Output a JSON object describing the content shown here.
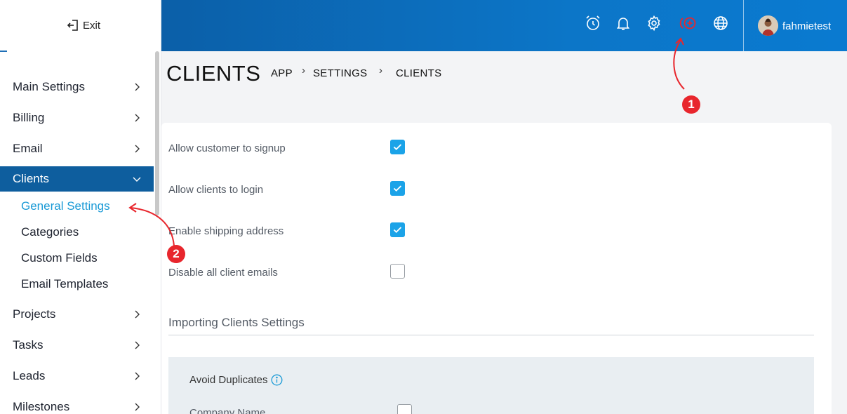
{
  "sidebar": {
    "exit_label": "Exit",
    "items": [
      {
        "label": "Main Settings"
      },
      {
        "label": "Billing"
      },
      {
        "label": "Email"
      },
      {
        "label": "Clients"
      },
      {
        "label": "Projects"
      },
      {
        "label": "Tasks"
      },
      {
        "label": "Leads"
      },
      {
        "label": "Milestones"
      }
    ],
    "clients_sub": [
      {
        "label": "General Settings"
      },
      {
        "label": "Categories"
      },
      {
        "label": "Custom Fields"
      },
      {
        "label": "Email Templates"
      }
    ]
  },
  "topbar": {
    "icons": [
      "alarm-clock-icon",
      "bell-icon",
      "gear-icon",
      "add-circle-icon",
      "globe-icon"
    ],
    "username": "fahmietest",
    "highlight_color": "#e8262d"
  },
  "header": {
    "title": "CLIENTS",
    "breadcrumb": [
      "APP",
      "SETTINGS",
      "CLIENTS"
    ]
  },
  "settings": {
    "options": [
      {
        "label": "Allow customer to signup",
        "checked": true
      },
      {
        "label": "Allow clients to login",
        "checked": true
      },
      {
        "label": "Enable shipping address",
        "checked": true
      },
      {
        "label": "Disable all client emails",
        "checked": false
      }
    ],
    "import_section_title": "Importing Clients Settings",
    "avoid_duplicates_label": "Avoid Duplicates",
    "company_name_label": "Company Name"
  },
  "annotations": {
    "badge_1": "1",
    "badge_2": "2"
  },
  "colors": {
    "accent": "#1ba3e8",
    "active_menu": "#0e5e9e",
    "topbar": "#0c6dbd"
  }
}
